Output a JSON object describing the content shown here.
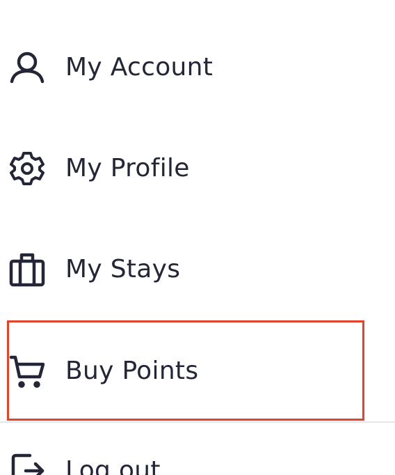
{
  "menu": {
    "items": [
      {
        "label": "My Account",
        "icon": "user-icon"
      },
      {
        "label": "My Profile",
        "icon": "gear-icon"
      },
      {
        "label": "My Stays",
        "icon": "suitcase-icon"
      },
      {
        "label": "Buy Points",
        "icon": "cart-icon"
      },
      {
        "label": "Log out",
        "icon": "logout-icon"
      }
    ],
    "highlighted_item": "Buy Points"
  },
  "colors": {
    "text": "#232637",
    "highlight": "#e2432a",
    "divider": "#e6e6e9"
  }
}
